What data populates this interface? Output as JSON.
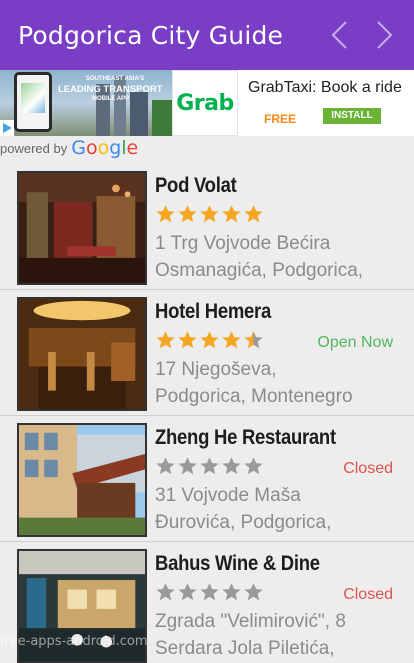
{
  "app": {
    "title": "Podgorica City Guide",
    "colors": {
      "appbar": "#7a3ec6",
      "star_gold": "#f5a623",
      "star_gray": "#9a9a9a",
      "open": "#53b65d",
      "closed": "#e0534a"
    }
  },
  "ad": {
    "banner_line1": "SOUTHEAST ASIA'S",
    "banner_line2": "LEADING TRANSPORT",
    "banner_line3": "MOBILE APP",
    "logo_text": "Grab",
    "headline": "GrabTaxi: Book a ride",
    "price": "FREE",
    "install_label": "INSTALL"
  },
  "powered_by": {
    "label": "powered by",
    "brand": [
      "G",
      "o",
      "o",
      "g",
      "l",
      "e"
    ]
  },
  "places": [
    {
      "name": "Pod Volat",
      "rating": 5,
      "status": "",
      "addr1": "1 Trg Vojvode Bećira",
      "addr2": "Osmanagića, Podgorica,"
    },
    {
      "name": "Hotel Hemera",
      "rating": 4.5,
      "status": "Open Now",
      "addr1": "17 Njegoševa,",
      "addr2": "Podgorica, Montenegro"
    },
    {
      "name": "Zheng He Restaurant",
      "rating": 0,
      "status": "Closed",
      "addr1": "31 Vojvode Maša",
      "addr2": "Đurovića, Podgorica,"
    },
    {
      "name": "Bahus Wine & Dine",
      "rating": 0,
      "status": "Closed",
      "addr1": "Zgrada \"Velimirović\", 8",
      "addr2": "Serdara Jola Piletića,"
    }
  ],
  "watermark": "free-apps-android.com"
}
